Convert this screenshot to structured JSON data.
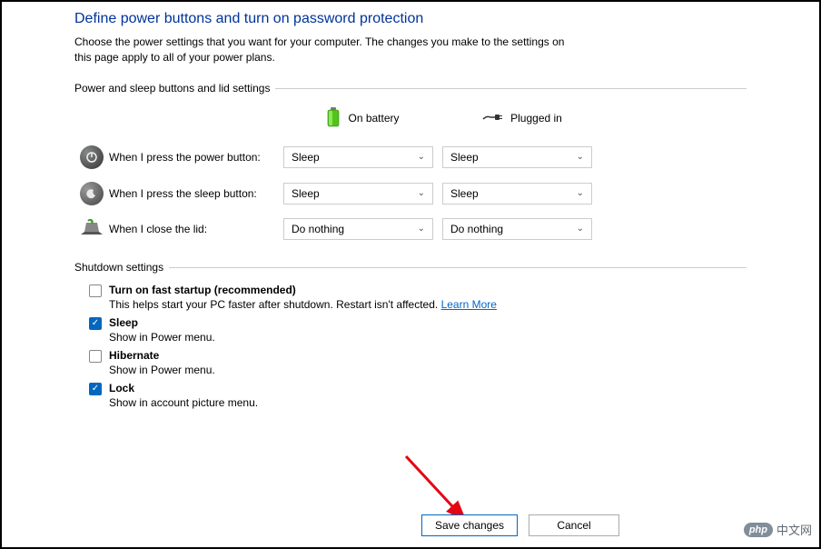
{
  "title": "Define power buttons and turn on password protection",
  "description": "Choose the power settings that you want for your computer. The changes you make to the settings on this page apply to all of your power plans.",
  "section1_label": "Power and sleep buttons and lid settings",
  "columns": {
    "battery": "On battery",
    "plugged": "Plugged in"
  },
  "rows": {
    "power": {
      "label": "When I press the power button:",
      "battery": "Sleep",
      "plugged": "Sleep"
    },
    "sleep": {
      "label": "When I press the sleep button:",
      "battery": "Sleep",
      "plugged": "Sleep"
    },
    "lid": {
      "label": "When I close the lid:",
      "battery": "Do nothing",
      "plugged": "Do nothing"
    }
  },
  "section2_label": "Shutdown settings",
  "shutdown": {
    "fast_startup": {
      "label": "Turn on fast startup (recommended)",
      "desc": "This helps start your PC faster after shutdown. Restart isn't affected. ",
      "link": "Learn More"
    },
    "sleep": {
      "label": "Sleep",
      "desc": "Show in Power menu."
    },
    "hibernate": {
      "label": "Hibernate",
      "desc": "Show in Power menu."
    },
    "lock": {
      "label": "Lock",
      "desc": "Show in account picture menu."
    }
  },
  "buttons": {
    "save": "Save changes",
    "cancel": "Cancel"
  },
  "watermark": {
    "badge": "php",
    "text": "中文网"
  }
}
